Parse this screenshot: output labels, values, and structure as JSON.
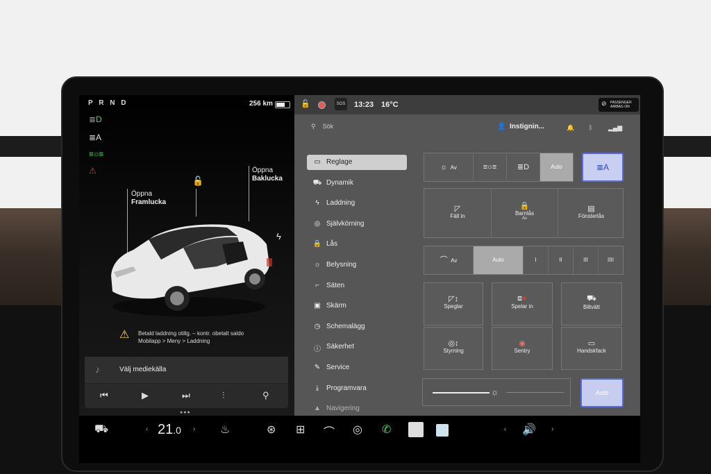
{
  "left": {
    "gear": "P R N D",
    "range": "256 km",
    "frunk": {
      "open": "Öppna",
      "name": "Framlucka"
    },
    "trunk": {
      "open": "Öppna",
      "name": "Baklucka"
    },
    "alert": {
      "line1": "Betald laddning otillg. – kontr. obetalt saldo",
      "line2": "Mobilapp > Meny > Laddning"
    },
    "media": {
      "source": "Välj mediekälla"
    }
  },
  "status": {
    "time": "13:23",
    "temp": "16°C",
    "sos": "SOS",
    "airbag_line1": "PASSENGER",
    "airbag_line2": "AIRBAG ON"
  },
  "top": {
    "search": "Sök",
    "user": "Instignin..."
  },
  "menu": [
    {
      "icon": "▭",
      "label": "Reglage",
      "active": true
    },
    {
      "icon": "⛟",
      "label": "Dynamik"
    },
    {
      "icon": "ϟ",
      "label": "Laddning"
    },
    {
      "icon": "◎",
      "label": "Självkörning"
    },
    {
      "icon": "🔒",
      "label": "Lås"
    },
    {
      "icon": "☼",
      "label": "Belysning"
    },
    {
      "icon": "⌐",
      "label": "Säten"
    },
    {
      "icon": "▣",
      "label": "Skärm"
    },
    {
      "icon": "◷",
      "label": "Schemalägg"
    },
    {
      "icon": "ⓘ",
      "label": "Säkerhet"
    },
    {
      "icon": "✎",
      "label": "Service"
    },
    {
      "icon": "⤓",
      "label": "Programvara"
    },
    {
      "icon": "▲",
      "label": "Navigering"
    }
  ],
  "lights": {
    "off": "Av",
    "auto": "Auto"
  },
  "doors": {
    "fold": "Fäll in",
    "child": "Barnlås",
    "child_state": "Av",
    "window": "Fönsterlås"
  },
  "wipers": {
    "off": "Av",
    "auto": "Auto",
    "l1": "I",
    "l2": "II",
    "l3": "III",
    "l4": "IIII"
  },
  "grid": {
    "mirrors": "Speglar",
    "dashcam": "Spelar in",
    "carwash": "Biltvätt",
    "steering": "Styrning",
    "sentry": "Sentry",
    "glovebox": "Handskfack"
  },
  "brightness": {
    "auto": "Auto"
  },
  "bottom": {
    "temp_int": "21",
    "temp_dec": ".0"
  }
}
